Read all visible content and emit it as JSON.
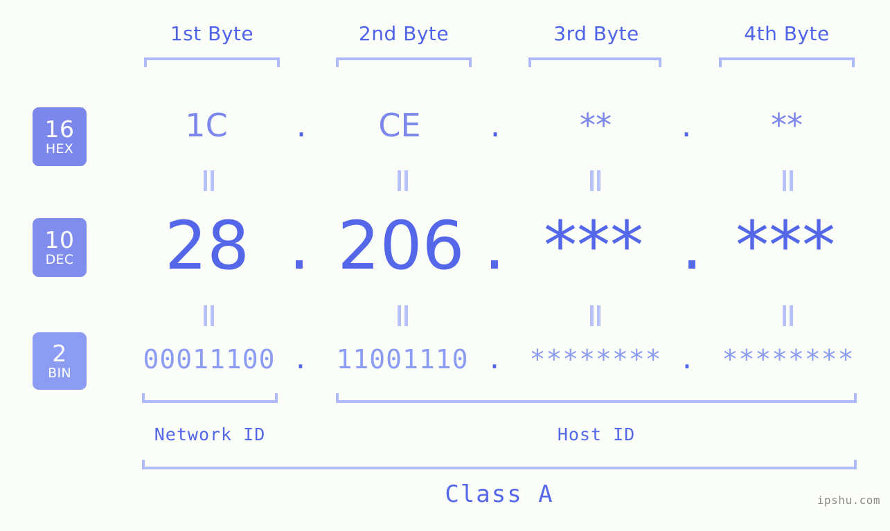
{
  "meta": {
    "background_color": "#fbfdf8",
    "accent_dark": "#5467e8",
    "accent_mid": "#7b87ea",
    "accent_light": "#8c9cf2",
    "accent_pale": "#afbbfa",
    "watermark": "ipshu.com"
  },
  "columns": [
    {
      "header": "1st Byte"
    },
    {
      "header": "2nd Byte"
    },
    {
      "header": "3rd Byte"
    },
    {
      "header": "4th Byte"
    }
  ],
  "rows": [
    {
      "base_number": "16",
      "base_name": "HEX",
      "badge_color": "#7b87ea",
      "values": [
        "1C",
        "CE",
        "**",
        "**"
      ],
      "separator": "."
    },
    {
      "base_number": "10",
      "base_name": "DEC",
      "badge_color": "#808ded",
      "values": [
        "28",
        "206",
        "***",
        "***"
      ],
      "separator": "."
    },
    {
      "base_number": "2",
      "base_name": "BIN",
      "badge_color": "#8c9cf2",
      "values": [
        "00011100",
        "11001110",
        "********",
        "********"
      ],
      "separator": "."
    }
  ],
  "connectors": {
    "symbol": "||"
  },
  "segments": {
    "network_id": "Network ID",
    "host_id": "Host ID"
  },
  "class_label": "Class A"
}
